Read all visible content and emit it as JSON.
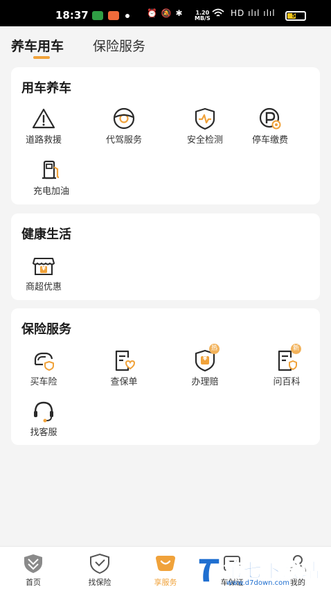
{
  "status_bar": {
    "time": "18:37",
    "system_icons": "⏰ 🔕 ✱",
    "net_speed_value": "1.20",
    "net_speed_unit": "MB/S",
    "signal": "HD ılıl ılıl",
    "battery": "52",
    "battery_fraction": 0.52
  },
  "top_tabs": [
    {
      "label": "养车用车",
      "active": true
    },
    {
      "label": "保险服务",
      "active": false
    }
  ],
  "sections": {
    "car_care": {
      "title": "用车养车",
      "items": [
        {
          "label": "道路救援",
          "icon": "warning-triangle-icon"
        },
        {
          "label": "代驾服务",
          "icon": "steering-wheel-icon"
        },
        {
          "label": "安全检测",
          "icon": "shield-pulse-icon"
        },
        {
          "label": "停车缴费",
          "icon": "parking-icon"
        },
        {
          "label": "充电加油",
          "icon": "fuel-pump-icon"
        }
      ]
    },
    "health_life": {
      "title": "健康生活",
      "items": [
        {
          "label": "商超优惠",
          "icon": "store-icon",
          "glyph": "¥"
        }
      ]
    },
    "insurance": {
      "title": "保险服务",
      "items": [
        {
          "label": "买车险",
          "icon": "car-shield-icon"
        },
        {
          "label": "查保单",
          "icon": "policy-document-icon"
        },
        {
          "label": "办理赔",
          "icon": "claim-shield-icon",
          "glyph": "¥",
          "badge": "热"
        },
        {
          "label": "问百科",
          "icon": "encyclopedia-icon",
          "badge": "新"
        },
        {
          "label": "找客服",
          "icon": "headset-icon"
        }
      ]
    }
  },
  "bottom_nav": [
    {
      "label": "首页",
      "icon": "home-shield-icon",
      "active": false
    },
    {
      "label": "找保险",
      "icon": "insurance-shield-icon",
      "active": false
    },
    {
      "label": "享服务",
      "icon": "service-smile-icon",
      "active": true
    },
    {
      "label": "车保证",
      "icon": "car-cert-icon",
      "active": false
    },
    {
      "label": "我的",
      "icon": "profile-icon",
      "active": false
    }
  ],
  "watermark": {
    "text": "第七下载站",
    "url": "www.d7down.com"
  },
  "colors": {
    "accent": "#f0a23a",
    "badge": "#f2b25a",
    "icon_stroke": "#2a2a2a",
    "background": "#f4f4f4",
    "card": "#ffffff",
    "watermark": "#1f6fd0"
  }
}
